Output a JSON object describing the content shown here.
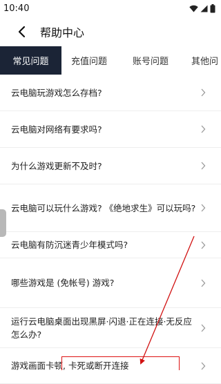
{
  "status_bar": {
    "time": "10:40"
  },
  "header": {
    "title": "帮助中心"
  },
  "tabs": [
    {
      "label": "常见问题",
      "active": true
    },
    {
      "label": "充值问题",
      "active": false
    },
    {
      "label": "账号问题",
      "active": false
    },
    {
      "label": "其他问",
      "active": false
    }
  ],
  "faq": [
    {
      "question": "云电脑玩游戏怎么存档?"
    },
    {
      "question": "云电脑对网络有要求吗?"
    },
    {
      "question": "为什么游戏更新不及时?"
    },
    {
      "question": "云电脑可以玩什么游戏? 《绝地求生》可以玩吗?"
    },
    {
      "question": "云电脑有防沉迷青少年模式吗?"
    },
    {
      "question": "哪些游戏是 (免帐号) 游戏?"
    },
    {
      "question": "运行云电脑桌面出现黑屏·闪退·正在连接·无反应怎么办?"
    },
    {
      "question": "游戏画面卡顿, 卡死或断开连接"
    }
  ],
  "colors": {
    "active_tab_bg": "#1b2436",
    "annotation": "#d11111"
  }
}
